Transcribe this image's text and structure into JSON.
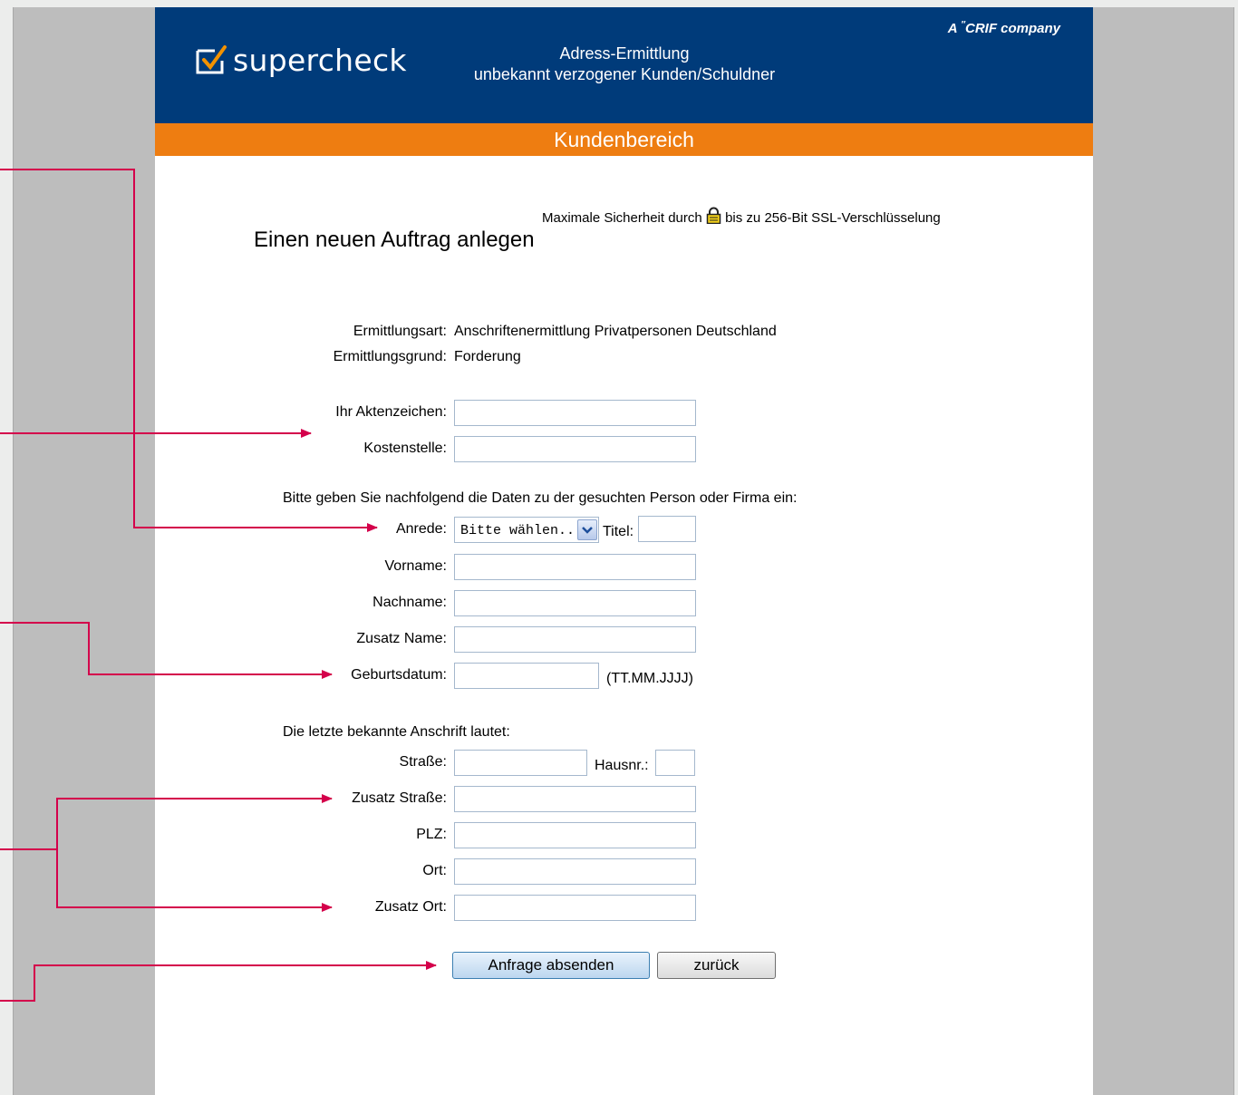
{
  "header": {
    "logo_text": "supercheck",
    "title_line1": "Adress-Ermittlung",
    "title_line2": "unbekannt verzogener Kunden/Schuldner",
    "crif_a": "A",
    "crif_rest": "CRIF company"
  },
  "nav": {
    "section": "Kundenbereich"
  },
  "security": {
    "before": "Maximale Sicherheit durch",
    "after": "bis zu 256-Bit SSL-Verschlüsselung"
  },
  "page_title": "Einen neuen Auftrag anlegen",
  "info": {
    "art_label": "Ermittlungsart:",
    "art_value": "Anschriftenermittlung Privatpersonen Deutschland",
    "grund_label": "Ermittlungsgrund:",
    "grund_value": "Forderung"
  },
  "form": {
    "aktenzeichen_label": "Ihr Aktenzeichen:",
    "kostenstelle_label": "Kostenstelle:",
    "person_intro": "Bitte geben Sie nachfolgend die Daten zu der gesuchten Person oder Firma ein:",
    "anrede_label": "Anrede:",
    "anrede_value": "Bitte wählen..",
    "titel_label": "Titel:",
    "vorname_label": "Vorname:",
    "nachname_label": "Nachname:",
    "zusatz_name_label": "Zusatz Name:",
    "geburtsdatum_label": "Geburtsdatum:",
    "geburtsdatum_hint": "(TT.MM.JJJJ)",
    "address_intro": "Die letzte bekannte Anschrift lautet:",
    "strasse_label": "Straße:",
    "hausnr_label": "Hausnr.:",
    "zusatz_strasse_label": "Zusatz Straße:",
    "plz_label": "PLZ:",
    "ort_label": "Ort:",
    "zusatz_ort_label": "Zusatz Ort:",
    "submit_label": "Anfrage absenden",
    "back_label": "zurück"
  },
  "colors": {
    "header_blue": "#003b7a",
    "orange": "#ee7d11",
    "arrow": "#d4004b"
  }
}
